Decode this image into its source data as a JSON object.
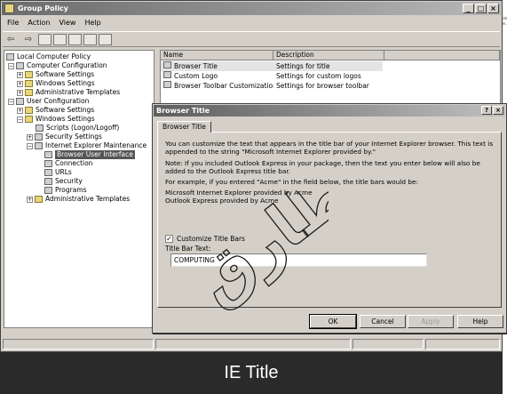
{
  "window": {
    "title": "Group Policy",
    "min": "_",
    "max": "□",
    "close": "×"
  },
  "menu": [
    "File",
    "Action",
    "View",
    "Help"
  ],
  "toolbar": {
    "back": "⇦",
    "forward": "⇨"
  },
  "tree": {
    "root": "Local Computer Policy",
    "computer_config": "Computer Configuration",
    "cc_software": "Software Settings",
    "cc_windows": "Windows Settings",
    "cc_admin": "Administrative Templates",
    "user_config": "User Configuration",
    "uc_software": "Software Settings",
    "uc_windows": "Windows Settings",
    "scripts": "Scripts (Logon/Logoff)",
    "security_settings": "Security Settings",
    "iem": "Internet Explorer Maintenance",
    "browser_ui": "Browser User Interface",
    "connection": "Connection",
    "urls": "URLs",
    "security": "Security",
    "programs": "Programs",
    "uc_admin": "Administrative Templates"
  },
  "list": {
    "col_name": "Name",
    "col_desc": "Description",
    "rows": [
      {
        "name": "Browser Title",
        "desc": "Settings for title"
      },
      {
        "name": "Custom Logo",
        "desc": "Settings for custom logos"
      },
      {
        "name": "Browser Toolbar Customizations",
        "desc": "Settings for browser toolbar"
      }
    ]
  },
  "dialog": {
    "title": "Browser Title",
    "help": "?",
    "close": "×",
    "tab": "Browser Title",
    "p1": "You can customize the text that appears in the title bar of your Internet Explorer browser. This text is appended to the string \"Microsoft Internet Explorer provided by.\"",
    "p2": "Note: If you included Outlook Express in your package, then the text you enter below will also be added to the Outlook Express title bar.",
    "p3": "For example, if you entered \"Acme\" in the field below, the title bars would be:",
    "ex1": "Microsoft Internet Explorer provided by Acme",
    "ex2": "Outlook Express provided by Acme",
    "checkbox_label": "Customize Title Bars",
    "checkbox_mark": "✓",
    "field_label": "Title Bar Text:",
    "field_value": "COMPUTING",
    "btn_ok": "OK",
    "btn_cancel": "Cancel",
    "btn_apply": "Apply",
    "btn_help": "Help"
  },
  "side_text": [
    "ow",
    "e."
  ],
  "caption": "IE Title",
  "watermark_text": "طارق"
}
